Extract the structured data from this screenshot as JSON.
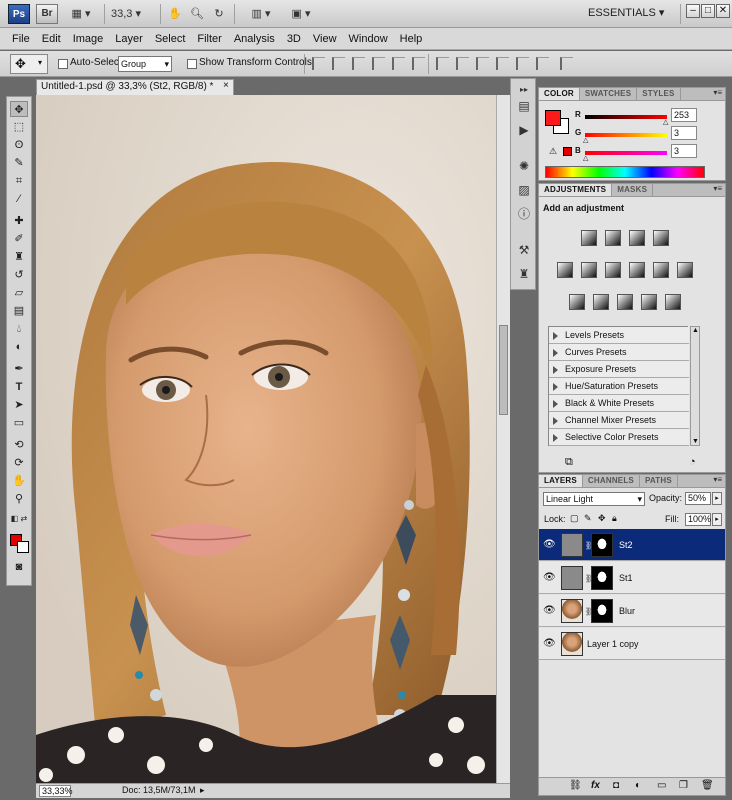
{
  "appbar": {
    "ps": "Ps",
    "br": "Br",
    "zoom": "33,3",
    "workspace": "ESSENTIALS",
    "win_min": "–",
    "win_max": "□",
    "win_close": "✕"
  },
  "menu": [
    "File",
    "Edit",
    "Image",
    "Layer",
    "Select",
    "Filter",
    "Analysis",
    "3D",
    "View",
    "Window",
    "Help"
  ],
  "options": {
    "auto_select_label": "Auto-Select:",
    "auto_select_value": "Group",
    "show_transform_label": "Show Transform Controls"
  },
  "document": {
    "tab_title": "Untitled-1.psd @ 33,3% (St2, RGB/8) *",
    "close": "×",
    "status_zoom": "33,33%",
    "status_doc": "Doc: 13,5M/73,1M"
  },
  "color_panel": {
    "tabs": [
      "COLOR",
      "SWATCHES",
      "STYLES"
    ],
    "r_label": "R",
    "g_label": "G",
    "b_label": "B",
    "r": "253",
    "g": "3",
    "b": "3"
  },
  "adjustments": {
    "tabs": [
      "ADJUSTMENTS",
      "MASKS"
    ],
    "title": "Add an adjustment",
    "presets": [
      "Levels Presets",
      "Curves Presets",
      "Exposure Presets",
      "Hue/Saturation Presets",
      "Black & White Presets",
      "Channel Mixer Presets",
      "Selective Color Presets"
    ]
  },
  "layers": {
    "tabs": [
      "LAYERS",
      "CHANNELS",
      "PATHS"
    ],
    "blend_mode": "Linear Light",
    "opacity_label": "Opacity:",
    "opacity": "50%",
    "lock_label": "Lock:",
    "fill_label": "Fill:",
    "fill": "100%",
    "rows": [
      {
        "name": "St2"
      },
      {
        "name": "St1"
      },
      {
        "name": "Blur"
      },
      {
        "name": "Layer 1 copy"
      }
    ]
  },
  "colors": {
    "foreground": "#e00000",
    "selected_layer": "#0b2b7a"
  }
}
